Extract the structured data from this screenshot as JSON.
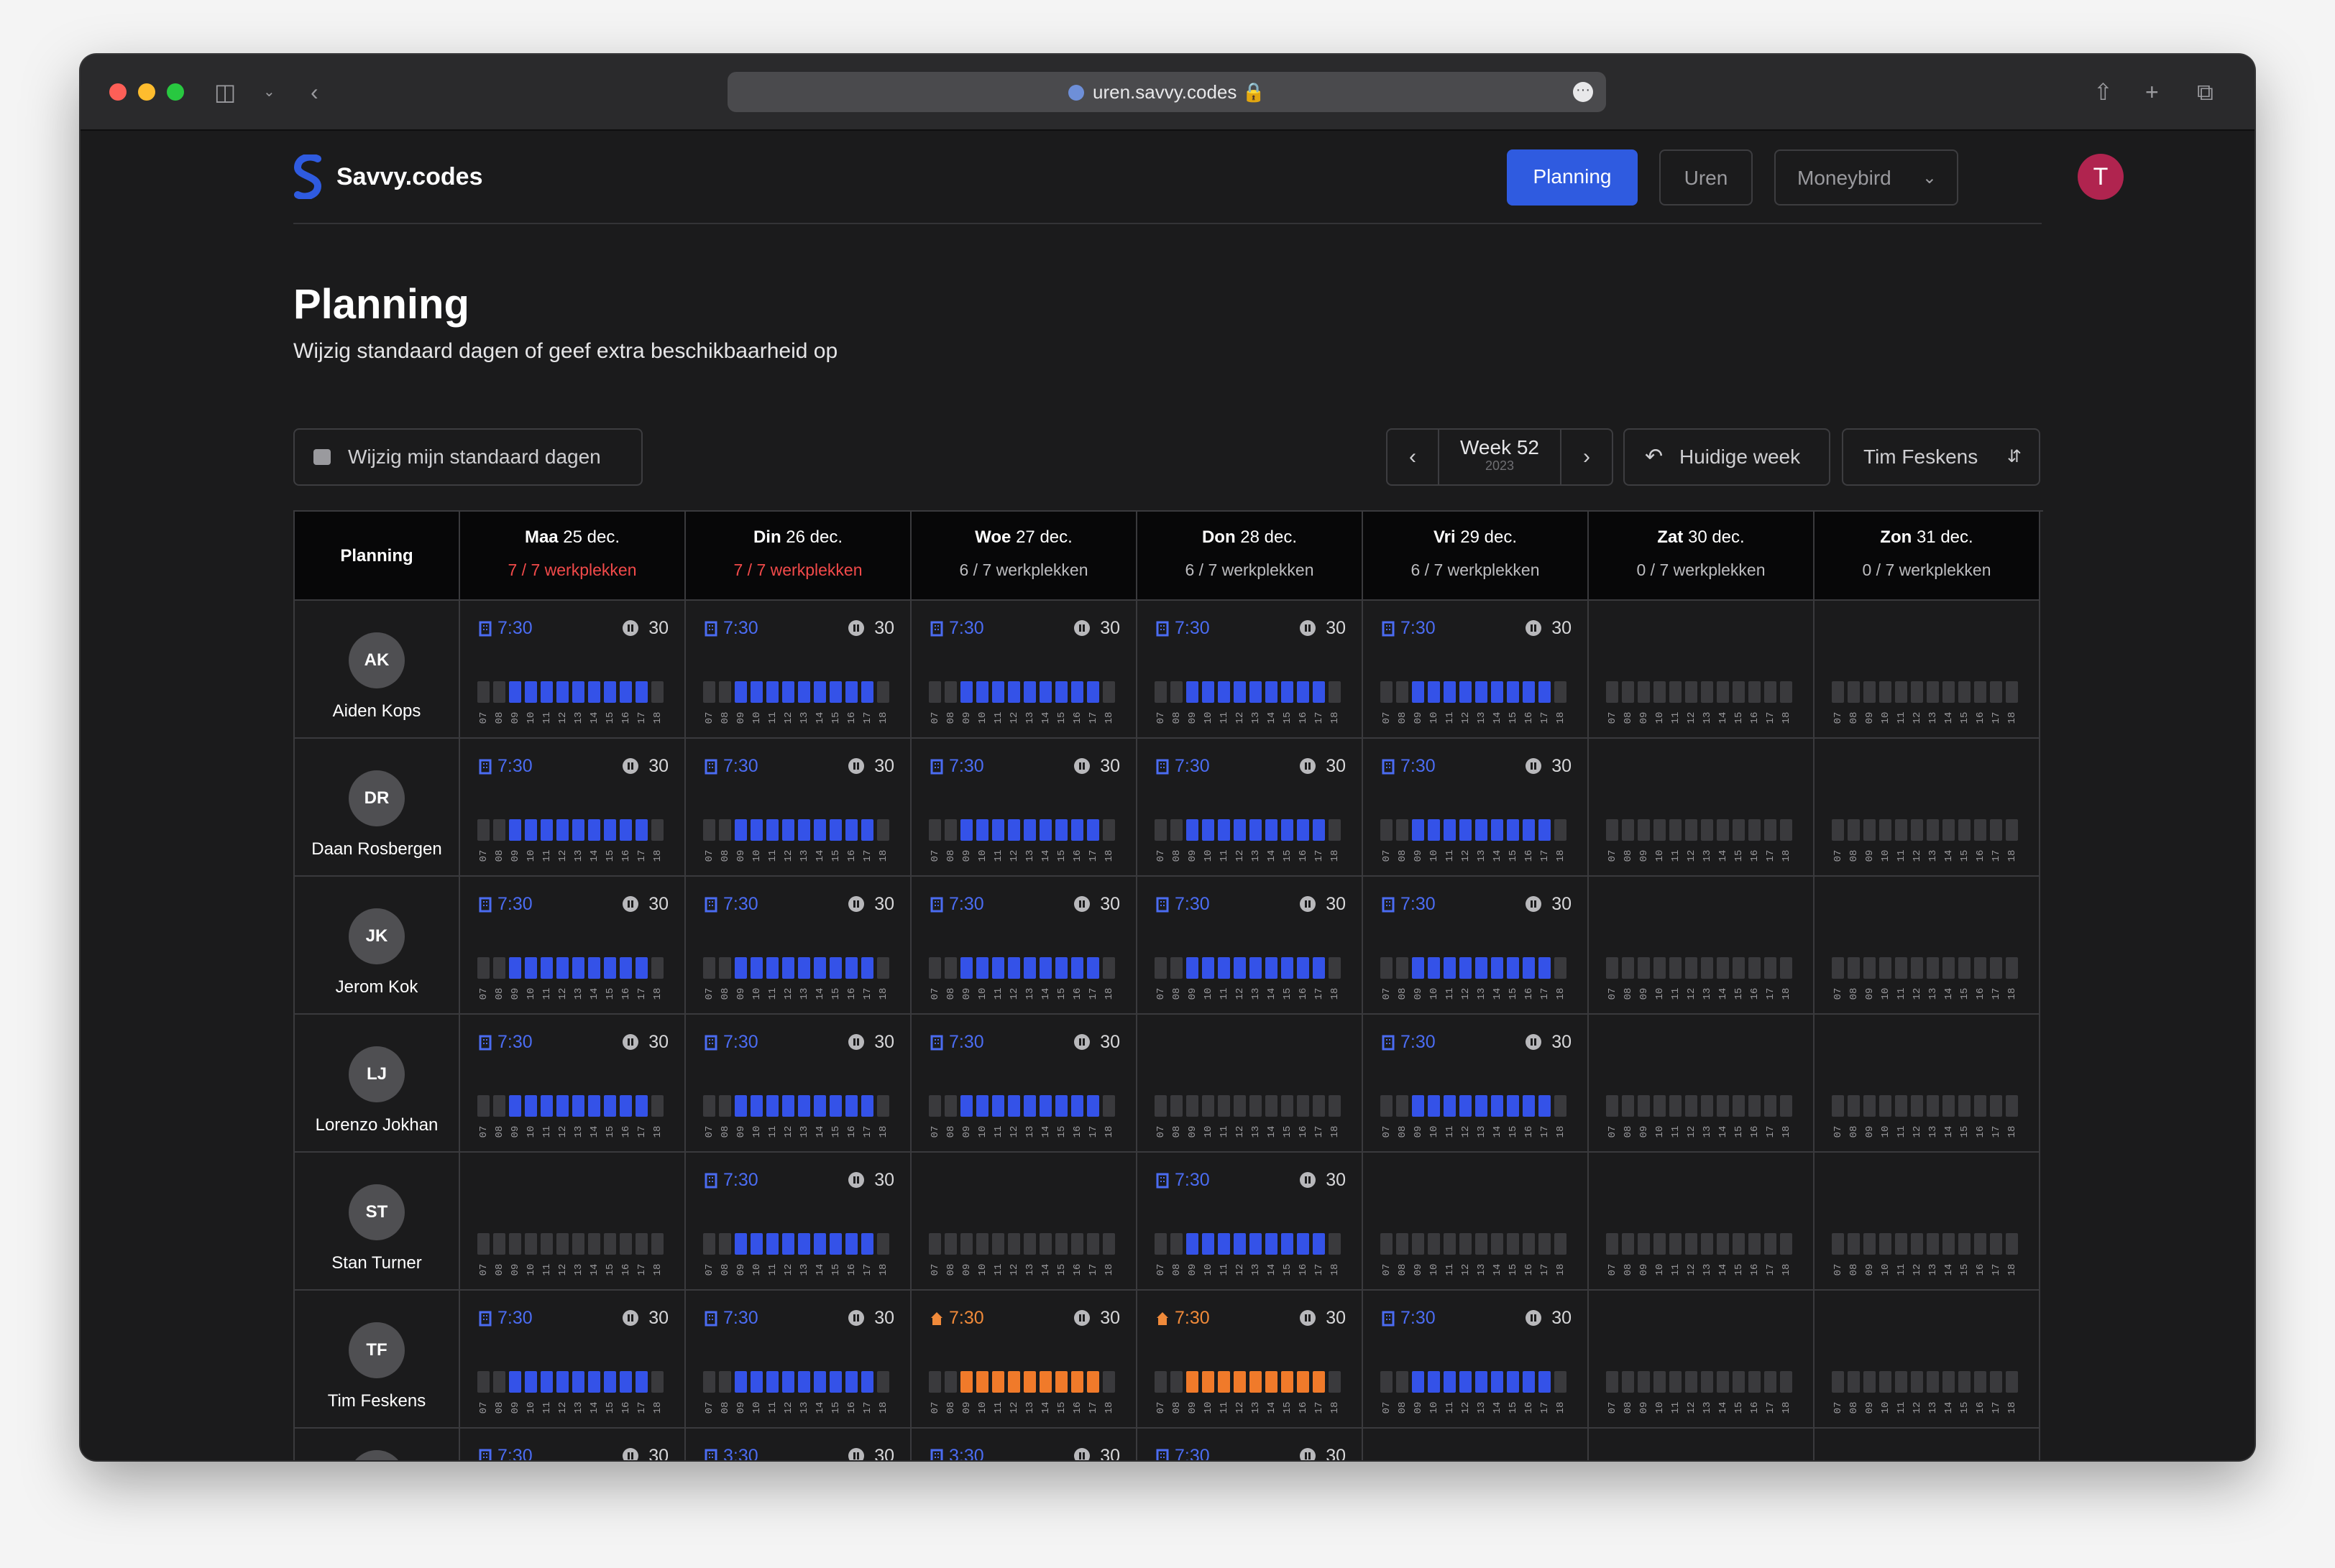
{
  "browser": {
    "url": "uren.savvy.codes"
  },
  "app": {
    "brand": "Savvy.codes",
    "nav": {
      "planning": "Planning",
      "uren": "Uren",
      "moneybird": "Moneybird"
    },
    "user_initial": "T"
  },
  "page": {
    "title": "Planning",
    "subtitle": "Wijzig standaard dagen of geef extra beschikbaarheid op",
    "edit_button": "Wijzig mijn standaard dagen",
    "week_label": "Week 52",
    "week_year": "2023",
    "current_week_button": "Huidige week",
    "person_select": "Tim Feskens"
  },
  "table": {
    "corner": "Planning",
    "days": [
      {
        "name": "Maa",
        "date": "25 dec.",
        "workplaces": "7 / 7 werkplekken",
        "full": true
      },
      {
        "name": "Din",
        "date": "26 dec.",
        "workplaces": "7 / 7 werkplekken",
        "full": true
      },
      {
        "name": "Woe",
        "date": "27 dec.",
        "workplaces": "6 / 7 werkplekken",
        "full": false
      },
      {
        "name": "Don",
        "date": "28 dec.",
        "workplaces": "6 / 7 werkplekken",
        "full": false
      },
      {
        "name": "Vri",
        "date": "29 dec.",
        "workplaces": "6 / 7 werkplekken",
        "full": false
      },
      {
        "name": "Zat",
        "date": "30 dec.",
        "workplaces": "0 / 7 werkplekken",
        "full": false
      },
      {
        "name": "Zon",
        "date": "31 dec.",
        "workplaces": "0 / 7 werkplekken",
        "full": false
      }
    ],
    "hour_ticks": [
      "07",
      "08",
      "09",
      "10",
      "11",
      "12",
      "13",
      "14",
      "15",
      "16",
      "17",
      "18"
    ],
    "rows": [
      {
        "initials": "AK",
        "name": "Aiden Kops",
        "cells": [
          {
            "hours": "7:30",
            "pause": "30",
            "loc": "office"
          },
          {
            "hours": "7:30",
            "pause": "30",
            "loc": "office"
          },
          {
            "hours": "7:30",
            "pause": "30",
            "loc": "office"
          },
          {
            "hours": "7:30",
            "pause": "30",
            "loc": "office"
          },
          {
            "hours": "7:30",
            "pause": "30",
            "loc": "office"
          },
          {
            "hours": "",
            "pause": "",
            "loc": "none"
          },
          {
            "hours": "",
            "pause": "",
            "loc": "none"
          }
        ]
      },
      {
        "initials": "DR",
        "name": "Daan Rosbergen",
        "cells": [
          {
            "hours": "7:30",
            "pause": "30",
            "loc": "office"
          },
          {
            "hours": "7:30",
            "pause": "30",
            "loc": "office"
          },
          {
            "hours": "7:30",
            "pause": "30",
            "loc": "office"
          },
          {
            "hours": "7:30",
            "pause": "30",
            "loc": "office"
          },
          {
            "hours": "7:30",
            "pause": "30",
            "loc": "office"
          },
          {
            "hours": "",
            "pause": "",
            "loc": "none"
          },
          {
            "hours": "",
            "pause": "",
            "loc": "none"
          }
        ]
      },
      {
        "initials": "JK",
        "name": "Jerom Kok",
        "cells": [
          {
            "hours": "7:30",
            "pause": "30",
            "loc": "office"
          },
          {
            "hours": "7:30",
            "pause": "30",
            "loc": "office"
          },
          {
            "hours": "7:30",
            "pause": "30",
            "loc": "office"
          },
          {
            "hours": "7:30",
            "pause": "30",
            "loc": "office"
          },
          {
            "hours": "7:30",
            "pause": "30",
            "loc": "office"
          },
          {
            "hours": "",
            "pause": "",
            "loc": "none"
          },
          {
            "hours": "",
            "pause": "",
            "loc": "none"
          }
        ]
      },
      {
        "initials": "LJ",
        "name": "Lorenzo Jokhan",
        "cells": [
          {
            "hours": "7:30",
            "pause": "30",
            "loc": "office"
          },
          {
            "hours": "7:30",
            "pause": "30",
            "loc": "office"
          },
          {
            "hours": "7:30",
            "pause": "30",
            "loc": "office"
          },
          {
            "hours": "",
            "pause": "",
            "loc": "none"
          },
          {
            "hours": "7:30",
            "pause": "30",
            "loc": "office"
          },
          {
            "hours": "",
            "pause": "",
            "loc": "none"
          },
          {
            "hours": "",
            "pause": "",
            "loc": "none"
          }
        ]
      },
      {
        "initials": "ST",
        "name": "Stan Turner",
        "cells": [
          {
            "hours": "",
            "pause": "",
            "loc": "none"
          },
          {
            "hours": "7:30",
            "pause": "30",
            "loc": "office"
          },
          {
            "hours": "",
            "pause": "",
            "loc": "none"
          },
          {
            "hours": "7:30",
            "pause": "30",
            "loc": "office"
          },
          {
            "hours": "",
            "pause": "",
            "loc": "none"
          },
          {
            "hours": "",
            "pause": "",
            "loc": "none"
          },
          {
            "hours": "",
            "pause": "",
            "loc": "none"
          }
        ]
      },
      {
        "initials": "TF",
        "name": "Tim Feskens",
        "cells": [
          {
            "hours": "7:30",
            "pause": "30",
            "loc": "office"
          },
          {
            "hours": "7:30",
            "pause": "30",
            "loc": "office"
          },
          {
            "hours": "7:30",
            "pause": "30",
            "loc": "home"
          },
          {
            "hours": "7:30",
            "pause": "30",
            "loc": "home"
          },
          {
            "hours": "7:30",
            "pause": "30",
            "loc": "office"
          },
          {
            "hours": "",
            "pause": "",
            "loc": "none"
          },
          {
            "hours": "",
            "pause": "",
            "loc": "none"
          }
        ]
      },
      {
        "initials": "",
        "name": "",
        "cells": [
          {
            "hours": "7:30",
            "pause": "30",
            "loc": "office"
          },
          {
            "hours": "3:30",
            "pause": "30",
            "loc": "office"
          },
          {
            "hours": "3:30",
            "pause": "30",
            "loc": "office"
          },
          {
            "hours": "7:30",
            "pause": "30",
            "loc": "office"
          },
          {
            "hours": "",
            "pause": "",
            "loc": "none"
          },
          {
            "hours": "",
            "pause": "",
            "loc": "none"
          },
          {
            "hours": "",
            "pause": "",
            "loc": "none"
          }
        ]
      }
    ]
  },
  "colors": {
    "accent": "#2f5be0",
    "office": "#3452e8",
    "home": "#f07a2a",
    "full": "#f24a4a"
  }
}
